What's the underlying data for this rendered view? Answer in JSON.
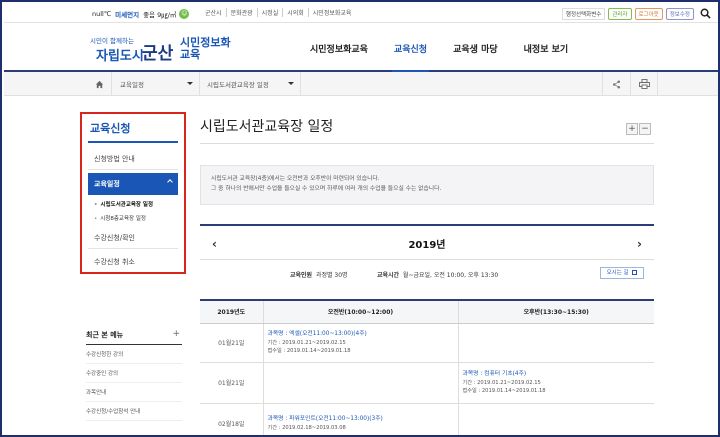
{
  "topbar": {
    "weather": "null℃",
    "dust_label": "미세먼지",
    "dust_value": "좋음 9㎍/㎥",
    "links": [
      "군산시",
      "문화관광",
      "시정실",
      "시의회",
      "시민정보화교육"
    ],
    "right_text": "행정선택화변수",
    "pills": [
      "관리자",
      "로그아웃",
      "정보수정"
    ]
  },
  "header": {
    "logo_sub": "시민이 함께하는",
    "logo_main": "자립도시",
    "logo_brand": "군산",
    "logo_title_1": "시민정보화",
    "logo_title_2": "교육",
    "nav": [
      "시민정보화교육",
      "교육신청",
      "교육생 마당",
      "내정보 보기"
    ]
  },
  "breadcrumb": {
    "level1": "교육일정",
    "level2": "시립도서관교육장 일정"
  },
  "lnb": {
    "title": "교육신청",
    "items": [
      "신청방법 안내",
      "교육일정",
      "수강신청/확인",
      "수강신청 취소"
    ],
    "subitems": [
      "시립도서관교육장 일정",
      "시청8층교육장 일정"
    ]
  },
  "recent": {
    "title": "최근 본 메뉴",
    "plus": "+",
    "items": [
      "수강신청한 강의",
      "수강중인 강의",
      "과목안내",
      "수강신청/수업참석 안내"
    ]
  },
  "content": {
    "title": "시립도서관교육장 일정",
    "fs_plus": "+",
    "fs_minus": "−",
    "notice_1": "시립도서관 교육장(4층)에서는 오전반과 오후반이 마련되어 있습니다.",
    "notice_2": "그 중 하나의 반에서만 수업을 들으실 수 있으며 하루에 여러 개의 수업을 들으실 수는 없습니다.",
    "prev": "‹",
    "next": "›",
    "year": "2019년",
    "capacity_label": "교육인원",
    "capacity_value": "과정별 30명",
    "time_label": "교육시간",
    "time_value": "월~금요일, 오전 10:00, 오후 13:30",
    "map_button": "오시는 길"
  },
  "table": {
    "headers": [
      "2019년도",
      "오전반(10:00~12:00)",
      "오후반(13:30~15:30)"
    ],
    "rows": [
      {
        "date": "01월21일",
        "am": {
          "name": "과목명 : 엑셀(오전11:00~13:00)(4주)",
          "period": "기간 : 2019.01.21~2019.02.15",
          "apply": "접수일 : 2019.01.14~2019.01.18"
        },
        "pm": {
          "name": "",
          "period": "",
          "apply": ""
        }
      },
      {
        "date": "01월21일",
        "am": {
          "name": "",
          "period": "",
          "apply": ""
        },
        "pm": {
          "name": "과목명 : 컴퓨터 기초(4주)",
          "period": "기간 : 2019.01.21~2019.02.15",
          "apply": "접수일 : 2019.01.14~2019.01.18"
        }
      },
      {
        "date": "02월18일",
        "am": {
          "name": "과목명 : 파워포인트(오전11:00~13:00)(3주)",
          "period": "기간 : 2019.02.18~2019.03.08",
          "apply": ""
        },
        "pm": {
          "name": "",
          "period": "",
          "apply": ""
        }
      }
    ]
  },
  "colors": {
    "accent": "#1a56b5",
    "navy": "#2a3c7a",
    "highlight_box": "#d8261c"
  }
}
